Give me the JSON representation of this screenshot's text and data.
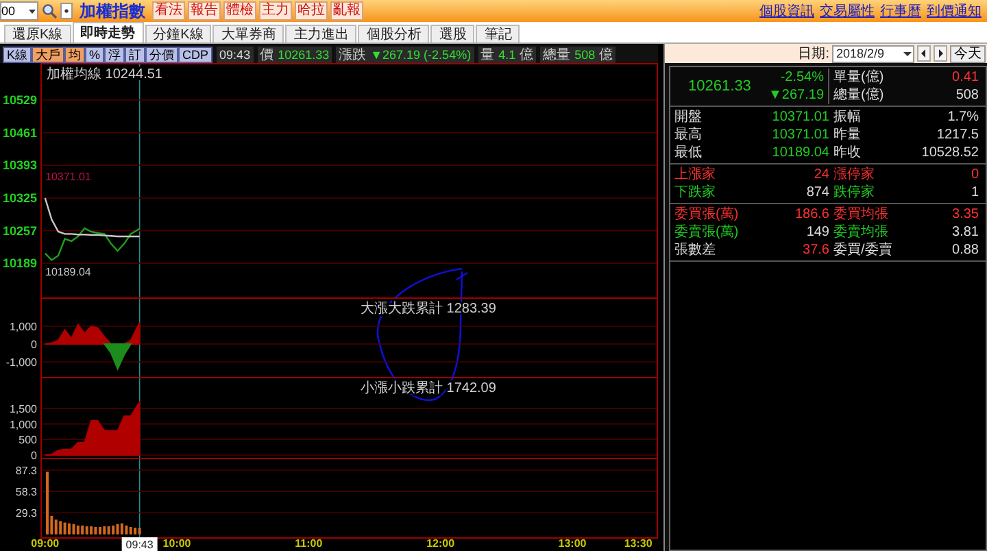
{
  "top_bar": {
    "symbol_input": "00",
    "title": "加權指數",
    "buttons": [
      "看法",
      "報告",
      "體檢",
      "主力",
      "哈拉",
      "亂報"
    ],
    "links": [
      "個股資訊",
      "交易屬性",
      "行事曆",
      "到價通知"
    ]
  },
  "tabs": [
    {
      "label": "還原K線",
      "selected": false
    },
    {
      "label": "即時走勢",
      "selected": true
    },
    {
      "label": "分鐘K線",
      "selected": false
    },
    {
      "label": "大單券商",
      "selected": false
    },
    {
      "label": "主力進出",
      "selected": false
    },
    {
      "label": "個股分析",
      "selected": false
    },
    {
      "label": "選股",
      "selected": false
    },
    {
      "label": "筆記",
      "selected": false
    }
  ],
  "toolbar": {
    "toggles": [
      {
        "label": "K線",
        "selected": false
      },
      {
        "label": "大戶",
        "selected": true
      },
      {
        "label": "均",
        "selected": true
      },
      {
        "label": "%",
        "selected": false
      },
      {
        "label": "浮",
        "selected": false
      },
      {
        "label": "訂",
        "selected": false
      },
      {
        "label": "分價",
        "selected": false
      },
      {
        "label": "CDP",
        "selected": false
      }
    ],
    "time": "09:43",
    "price": {
      "label": "價",
      "value": "10261.33"
    },
    "change": {
      "label": "漲跌",
      "value": "▼267.19 (-2.54%)"
    },
    "volume": {
      "label": "量",
      "value": "4.1",
      "unit": "億"
    },
    "total_volume": {
      "label": "總量",
      "value": "508",
      "unit": "億"
    }
  },
  "chart": {
    "cursor_time": "09:43",
    "panels": [
      {
        "high_label": {
          "text": "10371.01",
          "color": "#c0104a"
        },
        "low_label": {
          "text": "10189.04",
          "color": "#c8c8c8"
        },
        "chart_data": {
          "type": "line",
          "title": "加權均線 10244.51",
          "grid": true,
          "x": [
            9,
            9.05,
            9.1,
            9.15,
            9.2,
            9.25,
            9.3,
            9.35,
            9.4,
            9.45,
            9.5,
            9.55,
            9.6,
            9.65,
            9.717
          ],
          "xlim": [
            8.97,
            13.65
          ],
          "ylim": [
            10118,
            10606
          ],
          "yticks": [
            10529,
            10461,
            10393,
            10325,
            10257,
            10189
          ],
          "series": [
            {
              "color": "#1fa01f",
              "values": [
                10210,
                10196,
                10205,
                10240,
                10235,
                10245,
                10262,
                10255,
                10252,
                10250,
                10230,
                10215,
                10230,
                10250,
                10261
              ]
            },
            {
              "color": "#c8c8c8",
              "values": [
                10325,
                10280,
                10255,
                10250,
                10250,
                10249,
                10249,
                10248,
                10248,
                10247,
                10246,
                10245,
                10245,
                10245,
                10245
              ]
            }
          ]
        }
      },
      {
        "chart_data": {
          "type": "area",
          "title": "大漲大跌累計 1283.39",
          "grid": true,
          "x": [
            9,
            9.05,
            9.1,
            9.15,
            9.2,
            9.25,
            9.3,
            9.35,
            9.4,
            9.45,
            9.5,
            9.55,
            9.6,
            9.65,
            9.717
          ],
          "xlim": [
            8.97,
            13.65
          ],
          "ylim": [
            -1846,
            2615
          ],
          "yticks": [
            {
              "value": 1000,
              "label": "1,000"
            },
            0,
            {
              "value": -1000,
              "label": "-1,000"
            }
          ],
          "series": [
            {
              "color": "#b00000",
              "values": [
                0,
                50,
                200,
                800,
                300,
                1100,
                600,
                1000,
                900,
                400,
                0,
                null,
                0,
                200,
                1200
              ]
            },
            {
              "color": "#1c8c1c",
              "values": [
                null,
                null,
                null,
                null,
                null,
                null,
                null,
                null,
                null,
                0,
                -500,
                -1400,
                -600,
                0,
                null
              ]
            }
          ]
        }
      },
      {
        "chart_data": {
          "type": "area",
          "title": "小漲小跌累計 1742.09",
          "grid": true,
          "x": [
            9,
            9.05,
            9.1,
            9.15,
            9.2,
            9.25,
            9.3,
            9.35,
            9.4,
            9.45,
            9.5,
            9.55,
            9.6,
            9.65,
            9.717
          ],
          "xlim": [
            8.97,
            13.65
          ],
          "ylim": [
            -88,
            2511
          ],
          "yticks": [
            {
              "value": 1500,
              "label": "1,500"
            },
            {
              "value": 1000,
              "label": "1,000"
            },
            500,
            0
          ],
          "series": [
            {
              "color": "#b00000",
              "values": [
                0,
                20,
                150,
                180,
                180,
                400,
                400,
                1100,
                1100,
                780,
                780,
                780,
                1250,
                1250,
                1700
              ]
            }
          ]
        }
      },
      {
        "chart_data": {
          "type": "bar",
          "grid": true,
          "x": [
            9.017,
            9.05,
            9.083,
            9.117,
            9.15,
            9.183,
            9.217,
            9.25,
            9.283,
            9.317,
            9.35,
            9.383,
            9.417,
            9.45,
            9.483,
            9.517,
            9.55,
            9.583,
            9.617,
            9.65,
            9.683,
            9.717
          ],
          "xlim": [
            8.97,
            13.65
          ],
          "ylim": [
            -4,
            104
          ],
          "yticks": [
            87.3,
            58.3,
            29.3
          ],
          "values": [
            85,
            25,
            20,
            18,
            16,
            15,
            14,
            12,
            12,
            11,
            11,
            10,
            10,
            11,
            11,
            12,
            14,
            15,
            12,
            10,
            9,
            9
          ],
          "xticks": [
            {
              "value": 9,
              "label": "09:00"
            },
            {
              "value": 10,
              "label": "10:00"
            },
            {
              "value": 11,
              "label": "11:00"
            },
            {
              "value": 12,
              "label": "12:00"
            },
            {
              "value": 13,
              "label": "13:00"
            },
            {
              "value": 13.5,
              "label": "13:30"
            }
          ]
        }
      }
    ]
  },
  "date_bar": {
    "label": "日期:",
    "date": "2018/2/9",
    "today_button": "今天"
  },
  "quote": {
    "price": {
      "text": "10261.33",
      "color": "#22cc22"
    },
    "pct": {
      "text": "-2.54%",
      "color": "#22cc22"
    },
    "change": {
      "text": "▼267.19",
      "color": "#22cc22"
    },
    "side": [
      {
        "label": "單量(億)",
        "value": {
          "text": "0.41",
          "color": "#ff3030"
        }
      },
      {
        "label": "總量(億)",
        "value": {
          "text": "508",
          "color": "#dcdcdc"
        }
      }
    ]
  },
  "sections": [
    [
      {
        "cells": [
          {
            "label": {
              "text": "開盤",
              "color": "#dcdcdc"
            },
            "value": {
              "text": "10371.01",
              "color": "#22cc22"
            }
          },
          {
            "label": {
              "text": "振幅",
              "color": "#dcdcdc"
            },
            "value": {
              "text": "1.7%",
              "color": "#dcdcdc"
            }
          }
        ]
      },
      {
        "cells": [
          {
            "label": {
              "text": "最高",
              "color": "#dcdcdc"
            },
            "value": {
              "text": "10371.01",
              "color": "#22cc22"
            }
          },
          {
            "label": {
              "text": "昨量",
              "color": "#dcdcdc"
            },
            "value": {
              "text": "1217.5",
              "color": "#dcdcdc"
            }
          }
        ]
      },
      {
        "cells": [
          {
            "label": {
              "text": "最低",
              "color": "#dcdcdc"
            },
            "value": {
              "text": "10189.04",
              "color": "#22cc22"
            }
          },
          {
            "label": {
              "text": "昨收",
              "color": "#dcdcdc"
            },
            "value": {
              "text": "10528.52",
              "color": "#dcdcdc"
            }
          }
        ]
      }
    ],
    [
      {
        "cells": [
          {
            "label": {
              "text": "上漲家",
              "color": "#ff3030"
            },
            "value": {
              "text": "24",
              "color": "#ff3030"
            }
          },
          {
            "label": {
              "text": "漲停家",
              "color": "#ff3030"
            },
            "value": {
              "text": "0",
              "color": "#ff3030"
            }
          }
        ]
      },
      {
        "cells": [
          {
            "label": {
              "text": "下跌家",
              "color": "#22cc22"
            },
            "value": {
              "text": "874",
              "color": "#dcdcdc"
            }
          },
          {
            "label": {
              "text": "跌停家",
              "color": "#22cc22"
            },
            "value": {
              "text": "1",
              "color": "#dcdcdc"
            }
          }
        ]
      }
    ],
    [
      {
        "cells": [
          {
            "label": {
              "text": "委買張(萬)",
              "color": "#ff3030"
            },
            "value": {
              "text": "186.6",
              "color": "#ff3030"
            }
          },
          {
            "label": {
              "text": "委買均張",
              "color": "#ff3030"
            },
            "value": {
              "text": "3.35",
              "color": "#ff3030"
            }
          }
        ]
      },
      {
        "cells": [
          {
            "label": {
              "text": "委賣張(萬)",
              "color": "#22cc22"
            },
            "value": {
              "text": "149",
              "color": "#dcdcdc"
            }
          },
          {
            "label": {
              "text": "委賣均張",
              "color": "#22cc22"
            },
            "value": {
              "text": "3.81",
              "color": "#dcdcdc"
            }
          }
        ]
      },
      {
        "cells": [
          {
            "label": {
              "text": "張數差",
              "color": "#dcdcdc"
            },
            "value": {
              "text": "37.6",
              "color": "#ff3030"
            }
          },
          {
            "label": {
              "text": "委買/委賣",
              "color": "#dcdcdc"
            },
            "value": {
              "text": "0.88",
              "color": "#dcdcdc"
            }
          }
        ]
      }
    ]
  ]
}
